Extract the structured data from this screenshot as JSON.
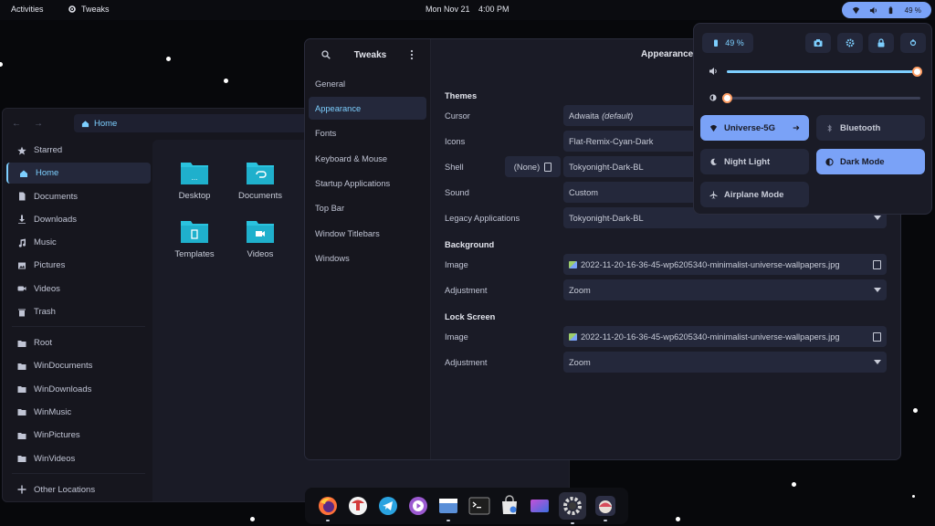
{
  "topbar": {
    "activities": "Activities",
    "app_name": "Tweaks",
    "date": "Mon Nov 21",
    "time": "4:00 PM",
    "battery": "49 %"
  },
  "files": {
    "path": "Home",
    "sidebar": [
      "Starred",
      "Home",
      "Documents",
      "Downloads",
      "Music",
      "Pictures",
      "Videos",
      "Trash",
      "Root",
      "WinDocuments",
      "WinDownloads",
      "WinMusic",
      "WinPictures",
      "WinVideos",
      "Other Locations"
    ],
    "folders": [
      "Desktop",
      "Documents",
      "Templates",
      "Videos"
    ],
    "folder_color": "#2ac3de"
  },
  "tweaks": {
    "title": "Tweaks",
    "panel_title": "Appearance",
    "nav": [
      "General",
      "Appearance",
      "Fonts",
      "Keyboard & Mouse",
      "Startup Applications",
      "Top Bar",
      "Window Titlebars",
      "Windows"
    ],
    "themes": {
      "heading": "Themes",
      "cursor_label": "Cursor",
      "cursor_value": "Adwaita",
      "cursor_suffix": "(default)",
      "icons_label": "Icons",
      "icons_value": "Flat-Remix-Cyan-Dark",
      "shell_label": "Shell",
      "shell_none": "(None)",
      "shell_value": "Tokyonight-Dark-BL",
      "sound_label": "Sound",
      "sound_value": "Custom",
      "legacy_label": "Legacy Applications",
      "legacy_value": "Tokyonight-Dark-BL"
    },
    "background": {
      "heading": "Background",
      "image_label": "Image",
      "image_value": "2022-11-20-16-36-45-wp6205340-minimalist-universe-wallpapers.jpg",
      "adjustment_label": "Adjustment",
      "adjustment_value": "Zoom"
    },
    "lockscreen": {
      "heading": "Lock Screen",
      "image_label": "Image",
      "image_value": "2022-11-20-16-36-45-wp6205340-minimalist-universe-wallpapers.jpg",
      "adjustment_label": "Adjustment",
      "adjustment_value": "Zoom"
    }
  },
  "quick_settings": {
    "battery": "49 %",
    "volume_level": 0.98,
    "brightness_level": 0.0,
    "wifi": "Universe-5G",
    "bluetooth": "Bluetooth",
    "night_light": "Night Light",
    "dark_mode": "Dark Mode",
    "airplane": "Airplane Mode"
  },
  "dock": {
    "apps": [
      "firefox-icon",
      "app-center-icon",
      "telegram-icon",
      "music-player-icon",
      "files-icon",
      "terminal-icon",
      "software-icon",
      "screenshot-icon",
      "settings-icon",
      "tweaks-icon"
    ]
  },
  "colors": {
    "accent": "#7aa2f7",
    "cyan": "#7dcfff",
    "bg": "#1a1b26"
  }
}
